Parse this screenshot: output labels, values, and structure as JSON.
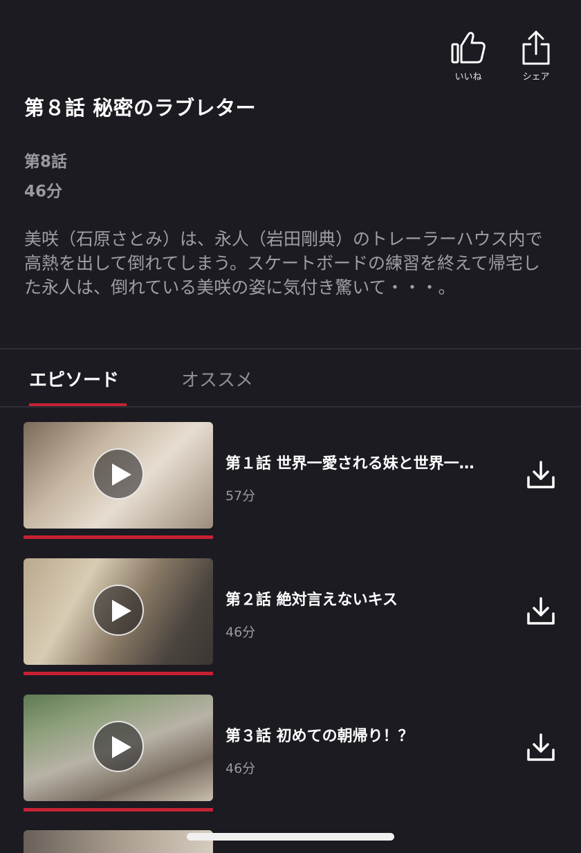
{
  "actions": {
    "like_label": "いいね",
    "share_label": "シェア"
  },
  "title": "第８話 秘密のラブレター",
  "episode_number": "第8話",
  "duration": "46分",
  "synopsis": "美咲（石原さとみ）は、永人（岩田剛典）のトレーラーハウス内で高熱を出して倒れてしまう。スケートボードの練習を終えて帰宅した永人は、倒れている美咲の姿に気付き驚いて・・・。",
  "tabs": [
    {
      "label": "エピソード",
      "active": true
    },
    {
      "label": "オススメ",
      "active": false
    }
  ],
  "episodes": [
    {
      "title": "第１話 世界一愛される妹と世界一…",
      "duration": "57分",
      "progress": 1.0,
      "play_icon": "play-icon",
      "download_icon": "download-icon"
    },
    {
      "title": "第２話 絶対言えないキス",
      "duration": "46分",
      "progress": 1.0,
      "play_icon": "play-icon",
      "download_icon": "download-icon"
    },
    {
      "title": "第３話 初めての朝帰り！？",
      "duration": "46分",
      "progress": 1.0,
      "play_icon": "play-icon",
      "download_icon": "download-icon"
    }
  ],
  "colors": {
    "background": "#1c1b22",
    "accent": "#c62234",
    "muted_text": "#9a9aa0"
  }
}
